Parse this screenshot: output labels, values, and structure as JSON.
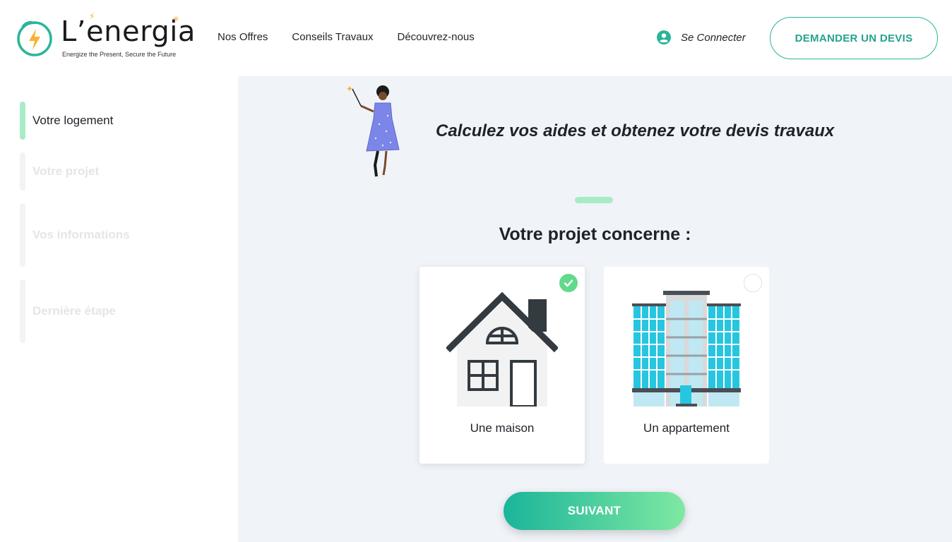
{
  "brand": {
    "name": "L’energia",
    "tagline": "Energize the Present, Secure the Future",
    "accent": "#2bb59a",
    "light_accent": "#a8ebc6",
    "spark_color": "#f6b232"
  },
  "nav": {
    "items": [
      {
        "label": "Nos Offres"
      },
      {
        "label": "Conseils Travaux"
      },
      {
        "label": "Découvrez-nous"
      }
    ]
  },
  "header": {
    "connect_label": "Se Connecter",
    "connect_icon": "user-circle-icon",
    "cta_label": "DEMANDER UN DEVIS"
  },
  "sidebar": {
    "steps": [
      {
        "label": "Votre logement",
        "active": true
      },
      {
        "label": "Votre projet",
        "active": false
      },
      {
        "label": "Vos informations",
        "active": false
      },
      {
        "label": "Dernière étape",
        "active": false
      }
    ]
  },
  "main": {
    "headline": "Calculez vos aides et obtenez votre devis travaux",
    "question": "Votre projet concerne :",
    "options": [
      {
        "label": "Une maison",
        "selected": true,
        "icon": "house-icon"
      },
      {
        "label": "Un appartement",
        "selected": false,
        "icon": "apartment-building-icon"
      }
    ],
    "next_label": "SUIVANT"
  }
}
